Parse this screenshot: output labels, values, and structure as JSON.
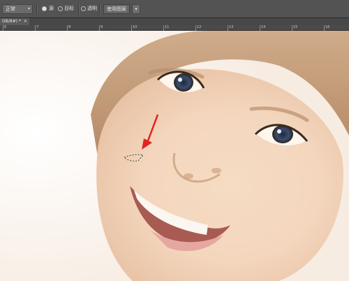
{
  "options_bar": {
    "mode_select": "正常",
    "radio_options": [
      {
        "label": "源",
        "selected": true
      },
      {
        "label": "目标",
        "selected": false
      },
      {
        "label": "透明",
        "selected": false
      }
    ],
    "pattern_button": "使用图案"
  },
  "document_tab": {
    "title": "GB/8#) *",
    "close": "×"
  },
  "ruler": {
    "labels": [
      "6",
      "7",
      "8",
      "9",
      "10",
      "11",
      "12",
      "13",
      "14",
      "15",
      "16"
    ]
  },
  "colors": {
    "arrow": "#e02424",
    "panel": "#535353"
  },
  "icons": {
    "dropdown": "chevron-down-icon",
    "swatch": "pattern-swatch-icon"
  }
}
